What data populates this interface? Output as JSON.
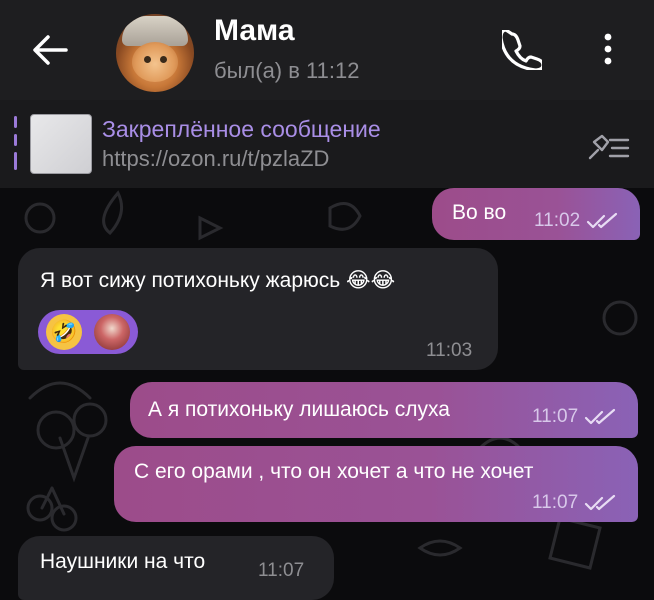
{
  "header": {
    "contact_name": "Мама",
    "status": "был(а) в 11:12"
  },
  "pinned": {
    "title": "Закреплённое сообщение",
    "link": "https://ozon.ru/t/pzlaZD"
  },
  "messages": [
    {
      "direction": "out",
      "text": "Во во",
      "time": "11:02",
      "read": true
    },
    {
      "direction": "in",
      "text": "Я вот сижу потихоньку жарюсь 😂😂",
      "time": "11:03",
      "reaction": "🤣"
    },
    {
      "direction": "out",
      "text": "А я потихоньку лишаюсь слуха",
      "time": "11:07",
      "read": true
    },
    {
      "direction": "out",
      "text": "С его орами , что он хочет а что не хочет",
      "time": "11:07",
      "read": true
    },
    {
      "direction": "in",
      "text": "Наушники на что",
      "time": "11:07"
    }
  ],
  "colors": {
    "accent": "#9b7ad8",
    "outgoing_start": "#9c4c8a",
    "outgoing_end": "#8a62b6",
    "incoming": "#242428",
    "header_bg": "#1e1e20"
  },
  "icons": {
    "back": "arrow-left-icon",
    "call": "phone-icon",
    "menu": "more-vertical-icon",
    "unpin": "unpin-list-icon"
  }
}
